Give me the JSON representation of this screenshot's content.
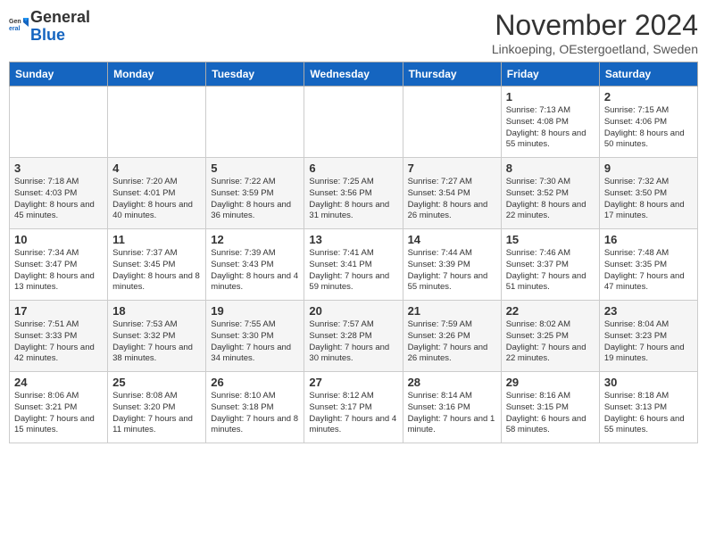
{
  "header": {
    "logo_general": "General",
    "logo_blue": "Blue",
    "month_year": "November 2024",
    "location": "Linkoeping, OEstergoetland, Sweden"
  },
  "days_of_week": [
    "Sunday",
    "Monday",
    "Tuesday",
    "Wednesday",
    "Thursday",
    "Friday",
    "Saturday"
  ],
  "weeks": [
    [
      {
        "day": "",
        "info": ""
      },
      {
        "day": "",
        "info": ""
      },
      {
        "day": "",
        "info": ""
      },
      {
        "day": "",
        "info": ""
      },
      {
        "day": "",
        "info": ""
      },
      {
        "day": "1",
        "info": "Sunrise: 7:13 AM\nSunset: 4:08 PM\nDaylight: 8 hours and 55 minutes."
      },
      {
        "day": "2",
        "info": "Sunrise: 7:15 AM\nSunset: 4:06 PM\nDaylight: 8 hours and 50 minutes."
      }
    ],
    [
      {
        "day": "3",
        "info": "Sunrise: 7:18 AM\nSunset: 4:03 PM\nDaylight: 8 hours and 45 minutes."
      },
      {
        "day": "4",
        "info": "Sunrise: 7:20 AM\nSunset: 4:01 PM\nDaylight: 8 hours and 40 minutes."
      },
      {
        "day": "5",
        "info": "Sunrise: 7:22 AM\nSunset: 3:59 PM\nDaylight: 8 hours and 36 minutes."
      },
      {
        "day": "6",
        "info": "Sunrise: 7:25 AM\nSunset: 3:56 PM\nDaylight: 8 hours and 31 minutes."
      },
      {
        "day": "7",
        "info": "Sunrise: 7:27 AM\nSunset: 3:54 PM\nDaylight: 8 hours and 26 minutes."
      },
      {
        "day": "8",
        "info": "Sunrise: 7:30 AM\nSunset: 3:52 PM\nDaylight: 8 hours and 22 minutes."
      },
      {
        "day": "9",
        "info": "Sunrise: 7:32 AM\nSunset: 3:50 PM\nDaylight: 8 hours and 17 minutes."
      }
    ],
    [
      {
        "day": "10",
        "info": "Sunrise: 7:34 AM\nSunset: 3:47 PM\nDaylight: 8 hours and 13 minutes."
      },
      {
        "day": "11",
        "info": "Sunrise: 7:37 AM\nSunset: 3:45 PM\nDaylight: 8 hours and 8 minutes."
      },
      {
        "day": "12",
        "info": "Sunrise: 7:39 AM\nSunset: 3:43 PM\nDaylight: 8 hours and 4 minutes."
      },
      {
        "day": "13",
        "info": "Sunrise: 7:41 AM\nSunset: 3:41 PM\nDaylight: 7 hours and 59 minutes."
      },
      {
        "day": "14",
        "info": "Sunrise: 7:44 AM\nSunset: 3:39 PM\nDaylight: 7 hours and 55 minutes."
      },
      {
        "day": "15",
        "info": "Sunrise: 7:46 AM\nSunset: 3:37 PM\nDaylight: 7 hours and 51 minutes."
      },
      {
        "day": "16",
        "info": "Sunrise: 7:48 AM\nSunset: 3:35 PM\nDaylight: 7 hours and 47 minutes."
      }
    ],
    [
      {
        "day": "17",
        "info": "Sunrise: 7:51 AM\nSunset: 3:33 PM\nDaylight: 7 hours and 42 minutes."
      },
      {
        "day": "18",
        "info": "Sunrise: 7:53 AM\nSunset: 3:32 PM\nDaylight: 7 hours and 38 minutes."
      },
      {
        "day": "19",
        "info": "Sunrise: 7:55 AM\nSunset: 3:30 PM\nDaylight: 7 hours and 34 minutes."
      },
      {
        "day": "20",
        "info": "Sunrise: 7:57 AM\nSunset: 3:28 PM\nDaylight: 7 hours and 30 minutes."
      },
      {
        "day": "21",
        "info": "Sunrise: 7:59 AM\nSunset: 3:26 PM\nDaylight: 7 hours and 26 minutes."
      },
      {
        "day": "22",
        "info": "Sunrise: 8:02 AM\nSunset: 3:25 PM\nDaylight: 7 hours and 22 minutes."
      },
      {
        "day": "23",
        "info": "Sunrise: 8:04 AM\nSunset: 3:23 PM\nDaylight: 7 hours and 19 minutes."
      }
    ],
    [
      {
        "day": "24",
        "info": "Sunrise: 8:06 AM\nSunset: 3:21 PM\nDaylight: 7 hours and 15 minutes."
      },
      {
        "day": "25",
        "info": "Sunrise: 8:08 AM\nSunset: 3:20 PM\nDaylight: 7 hours and 11 minutes."
      },
      {
        "day": "26",
        "info": "Sunrise: 8:10 AM\nSunset: 3:18 PM\nDaylight: 7 hours and 8 minutes."
      },
      {
        "day": "27",
        "info": "Sunrise: 8:12 AM\nSunset: 3:17 PM\nDaylight: 7 hours and 4 minutes."
      },
      {
        "day": "28",
        "info": "Sunrise: 8:14 AM\nSunset: 3:16 PM\nDaylight: 7 hours and 1 minute."
      },
      {
        "day": "29",
        "info": "Sunrise: 8:16 AM\nSunset: 3:15 PM\nDaylight: 6 hours and 58 minutes."
      },
      {
        "day": "30",
        "info": "Sunrise: 8:18 AM\nSunset: 3:13 PM\nDaylight: 6 hours and 55 minutes."
      }
    ]
  ]
}
